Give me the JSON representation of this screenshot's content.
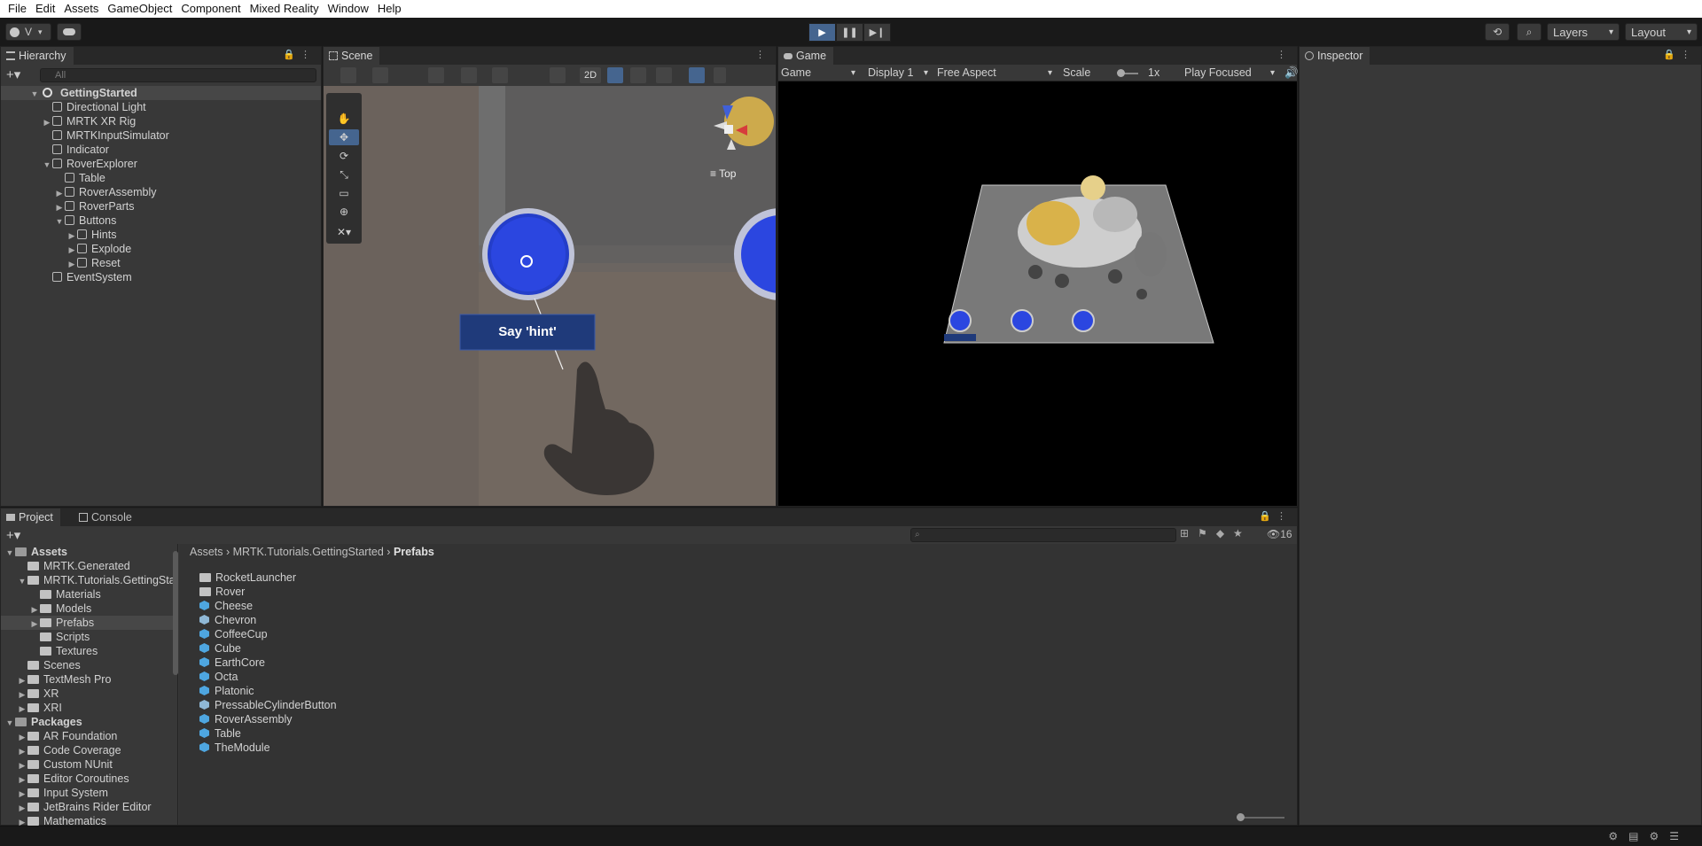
{
  "menu": [
    "File",
    "Edit",
    "Assets",
    "GameObject",
    "Component",
    "Mixed Reality",
    "Window",
    "Help"
  ],
  "toolbar": {
    "account_label": "V",
    "layers_label": "Layers",
    "layout_label": "Layout"
  },
  "hierarchy": {
    "tab_label": "Hierarchy",
    "search_placeholder": "All",
    "root": "GettingStarted",
    "items": [
      {
        "label": "Directional Light",
        "depth": 1,
        "arrow": ""
      },
      {
        "label": "MRTK XR Rig",
        "depth": 1,
        "arrow": "▶"
      },
      {
        "label": "MRTKInputSimulator",
        "depth": 1,
        "arrow": ""
      },
      {
        "label": "Indicator",
        "depth": 1,
        "arrow": ""
      },
      {
        "label": "RoverExplorer",
        "depth": 1,
        "arrow": "▼"
      },
      {
        "label": "Table",
        "depth": 2,
        "arrow": ""
      },
      {
        "label": "RoverAssembly",
        "depth": 2,
        "arrow": "▶"
      },
      {
        "label": "RoverParts",
        "depth": 2,
        "arrow": "▶"
      },
      {
        "label": "Buttons",
        "depth": 2,
        "arrow": "▼"
      },
      {
        "label": "Hints",
        "depth": 3,
        "arrow": "▶"
      },
      {
        "label": "Explode",
        "depth": 3,
        "arrow": "▶"
      },
      {
        "label": "Reset",
        "depth": 3,
        "arrow": "▶"
      },
      {
        "label": "EventSystem",
        "depth": 1,
        "arrow": ""
      }
    ]
  },
  "scene": {
    "tab_label": "Scene",
    "mode_2d": "2D",
    "orientation_label": "Top",
    "hint_text": "Say 'hint'"
  },
  "game": {
    "tab_label": "Game",
    "view_mode": "Game",
    "display": "Display 1",
    "aspect": "Free Aspect",
    "scale_label": "Scale",
    "scale_value": "1x",
    "play_mode": "Play Focused"
  },
  "inspector": {
    "tab_label": "Inspector"
  },
  "project": {
    "tab_label": "Project",
    "console_label": "Console",
    "hidden_count": "16",
    "tree": [
      {
        "label": "Assets",
        "depth": 0,
        "arrow": "▼",
        "bold": true
      },
      {
        "label": "MRTK.Generated",
        "depth": 1,
        "arrow": ""
      },
      {
        "label": "MRTK.Tutorials.GettingSta",
        "depth": 1,
        "arrow": "▼"
      },
      {
        "label": "Materials",
        "depth": 2,
        "arrow": ""
      },
      {
        "label": "Models",
        "depth": 2,
        "arrow": "▶"
      },
      {
        "label": "Prefabs",
        "depth": 2,
        "arrow": "▶",
        "selected": true
      },
      {
        "label": "Scripts",
        "depth": 2,
        "arrow": ""
      },
      {
        "label": "Textures",
        "depth": 2,
        "arrow": ""
      },
      {
        "label": "Scenes",
        "depth": 1,
        "arrow": ""
      },
      {
        "label": "TextMesh Pro",
        "depth": 1,
        "arrow": "▶"
      },
      {
        "label": "XR",
        "depth": 1,
        "arrow": "▶"
      },
      {
        "label": "XRI",
        "depth": 1,
        "arrow": "▶"
      },
      {
        "label": "Packages",
        "depth": 0,
        "arrow": "▼",
        "bold": true
      },
      {
        "label": "AR Foundation",
        "depth": 1,
        "arrow": "▶"
      },
      {
        "label": "Code Coverage",
        "depth": 1,
        "arrow": "▶"
      },
      {
        "label": "Custom NUnit",
        "depth": 1,
        "arrow": "▶"
      },
      {
        "label": "Editor Coroutines",
        "depth": 1,
        "arrow": "▶"
      },
      {
        "label": "Input System",
        "depth": 1,
        "arrow": "▶"
      },
      {
        "label": "JetBrains Rider Editor",
        "depth": 1,
        "arrow": "▶"
      },
      {
        "label": "Mathematics",
        "depth": 1,
        "arrow": "▶"
      }
    ],
    "breadcrumb": [
      "Assets",
      "MRTK.Tutorials.GettingStarted",
      "Prefabs"
    ],
    "files": [
      {
        "label": "RocketLauncher",
        "kind": "folder"
      },
      {
        "label": "Rover",
        "kind": "folder"
      },
      {
        "label": "Cheese",
        "kind": "prefab"
      },
      {
        "label": "Chevron",
        "kind": "variant"
      },
      {
        "label": "CoffeeCup",
        "kind": "prefab"
      },
      {
        "label": "Cube",
        "kind": "prefab"
      },
      {
        "label": "EarthCore",
        "kind": "prefab"
      },
      {
        "label": "Octa",
        "kind": "prefab"
      },
      {
        "label": "Platonic",
        "kind": "prefab"
      },
      {
        "label": "PressableCylinderButton",
        "kind": "variant"
      },
      {
        "label": "RoverAssembly",
        "kind": "prefab"
      },
      {
        "label": "Table",
        "kind": "prefab"
      },
      {
        "label": "TheModule",
        "kind": "prefab"
      }
    ]
  }
}
